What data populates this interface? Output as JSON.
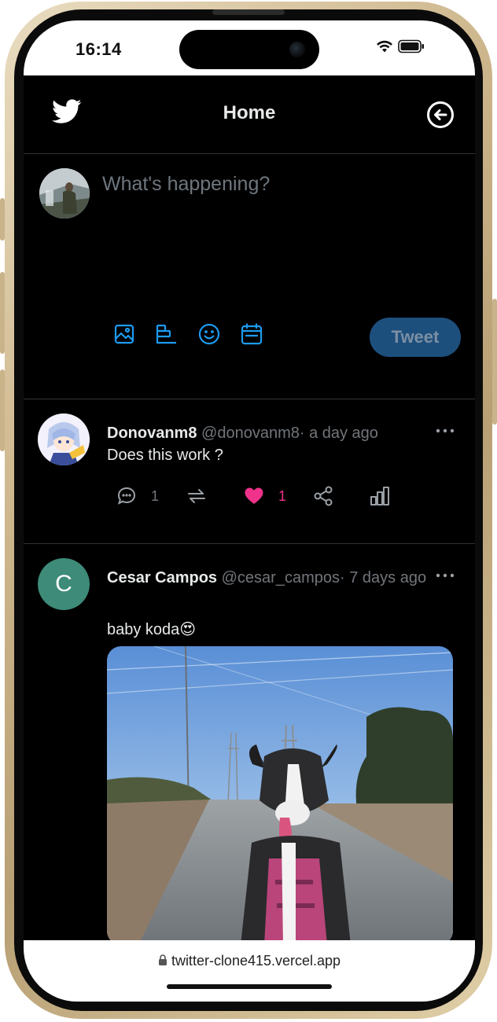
{
  "status_bar": {
    "time": "16:14"
  },
  "header": {
    "title": "Home"
  },
  "composer": {
    "placeholder": "What's happening?",
    "tweet_label": "Tweet"
  },
  "posts": [
    {
      "name": "Donovanm8",
      "handle": "@donovanm8",
      "time": "· a day ago",
      "text": "Does this work ?",
      "comments": "1",
      "likes": "1",
      "liked": true
    },
    {
      "name": "Cesar Campos",
      "handle": "@cesar_campos",
      "time": "· 7 days ago",
      "text": "baby koda😍",
      "avatar_letter": "C"
    }
  ],
  "browser": {
    "url": "twitter-clone415.vercel.app"
  },
  "colors": {
    "accent": "#1d9bf0",
    "like": "#f0328a",
    "tweet_button": "#1d4f7d",
    "avatar_c": "#3d8b78"
  },
  "icons": {
    "header": [
      "twitter-bird-icon",
      "back-arrow-icon"
    ],
    "composer": [
      "image-icon",
      "poll-icon",
      "emoji-icon",
      "schedule-icon"
    ],
    "post_actions": [
      "comment-icon",
      "retweet-icon",
      "heart-icon",
      "share-icon",
      "stats-icon"
    ],
    "browser": [
      "lock-icon"
    ]
  }
}
